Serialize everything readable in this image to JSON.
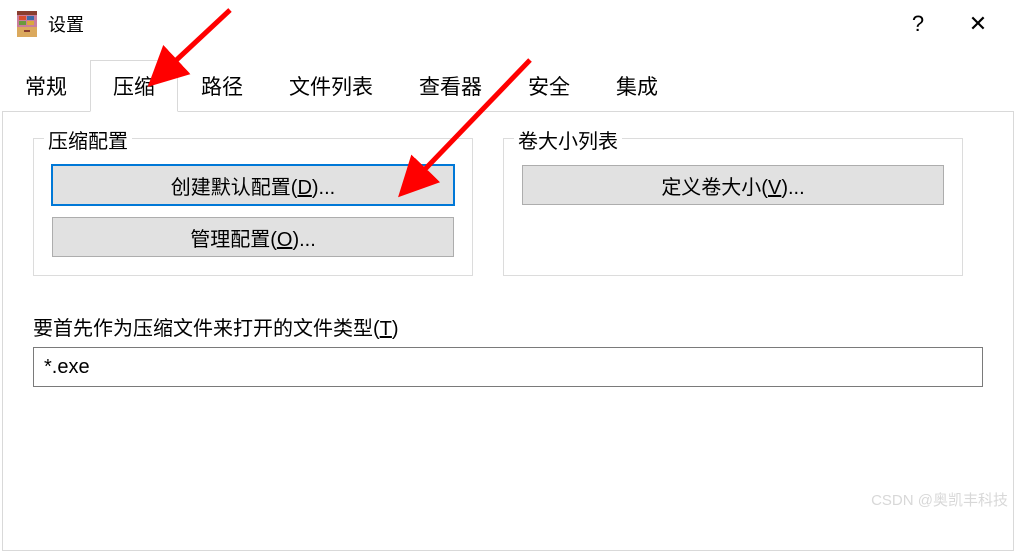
{
  "titlebar": {
    "title": "设置",
    "help_label": "?",
    "close_label": "✕"
  },
  "tabs": [
    {
      "label": "常规"
    },
    {
      "label": "压缩"
    },
    {
      "label": "路径"
    },
    {
      "label": "文件列表"
    },
    {
      "label": "查看器"
    },
    {
      "label": "安全"
    },
    {
      "label": "集成"
    }
  ],
  "active_tab_index": 1,
  "compress_group": {
    "title": "压缩配置",
    "create_default_prefix": "创建默认配置(",
    "create_default_mnemonic": "D",
    "create_default_suffix": ")...",
    "manage_prefix": "管理配置(",
    "manage_mnemonic": "O",
    "manage_suffix": ")..."
  },
  "volume_group": {
    "title": "卷大小列表",
    "define_prefix": "定义卷大小(",
    "define_mnemonic": "V",
    "define_suffix": ")..."
  },
  "file_types": {
    "label_prefix": "要首先作为压缩文件来打开的文件类型(",
    "label_mnemonic": "T",
    "label_suffix": ")",
    "value": "*.exe"
  },
  "watermark": "CSDN @奥凯丰科技"
}
